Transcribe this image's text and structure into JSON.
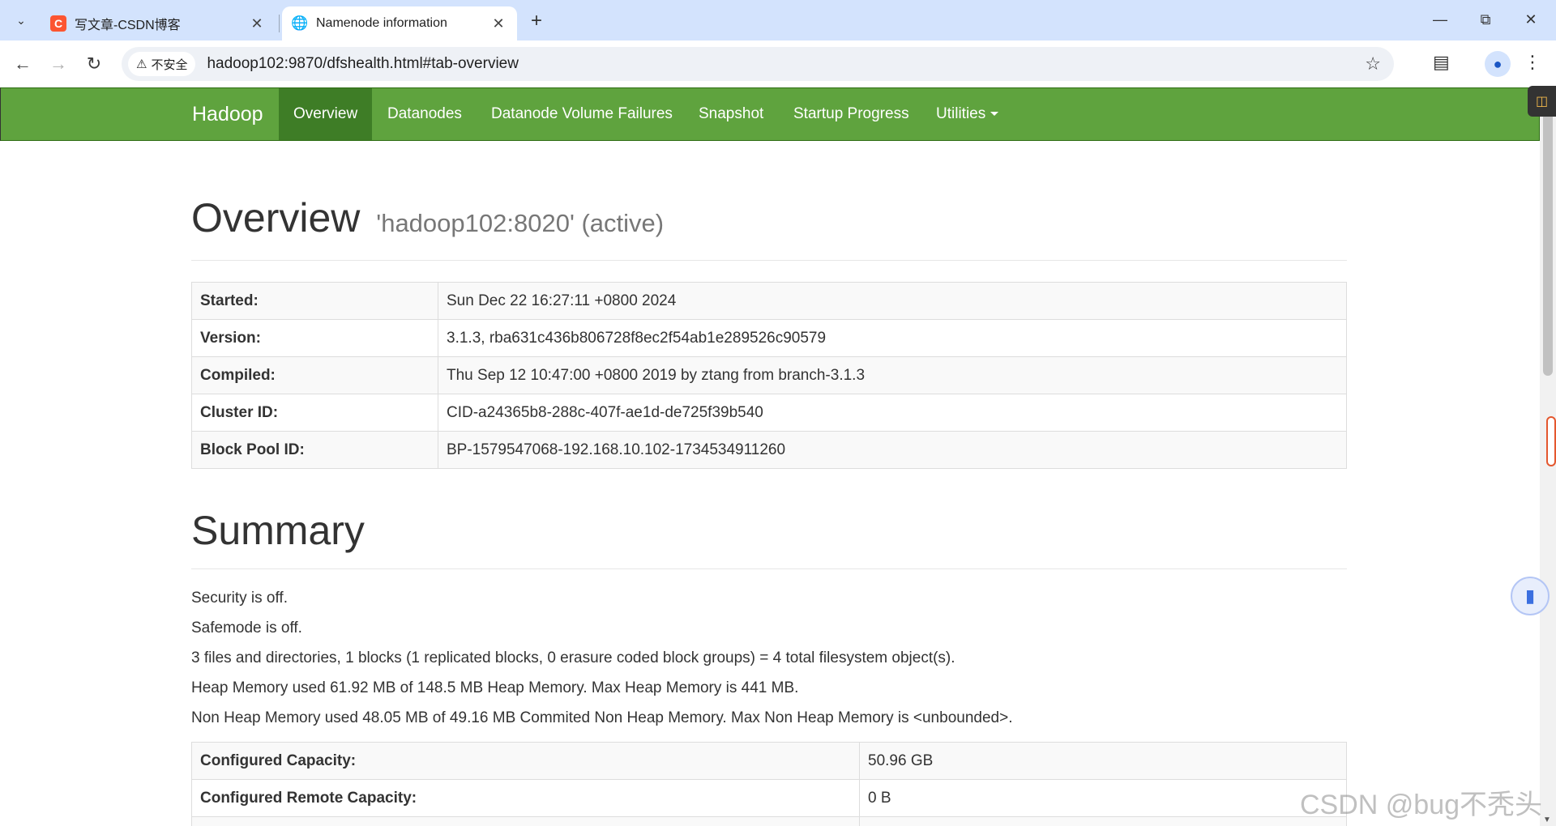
{
  "browser": {
    "tabs": [
      {
        "title": "写文章-CSDN博客",
        "favicon": "csdn-icon",
        "active": false
      },
      {
        "title": "Namenode information",
        "favicon": "globe-icon",
        "active": true
      }
    ],
    "security_label": "不安全",
    "url": "hadoop102:9870/dfshealth.html#tab-overview"
  },
  "navbar": {
    "brand": "Hadoop",
    "items": [
      "Overview",
      "Datanodes",
      "Datanode Volume Failures",
      "Snapshot",
      "Startup Progress",
      "Utilities"
    ],
    "active_item": "Overview"
  },
  "overview": {
    "heading": "Overview",
    "subheading": "'hadoop102:8020' (active)",
    "rows": [
      {
        "key": "Started:",
        "value": "Sun Dec 22 16:27:11 +0800 2024"
      },
      {
        "key": "Version:",
        "value": "3.1.3, rba631c436b806728f8ec2f54ab1e289526c90579"
      },
      {
        "key": "Compiled:",
        "value": "Thu Sep 12 10:47:00 +0800 2019 by ztang from branch-3.1.3"
      },
      {
        "key": "Cluster ID:",
        "value": "CID-a24365b8-288c-407f-ae1d-de725f39b540"
      },
      {
        "key": "Block Pool ID:",
        "value": "BP-1579547068-192.168.10.102-1734534911260"
      }
    ]
  },
  "summary": {
    "heading": "Summary",
    "lines": [
      "Security is off.",
      "Safemode is off.",
      "3 files and directories, 1 blocks (1 replicated blocks, 0 erasure coded block groups) = 4 total filesystem object(s).",
      "Heap Memory used 61.92 MB of 148.5 MB Heap Memory. Max Heap Memory is 441 MB.",
      "Non Heap Memory used 48.05 MB of 49.16 MB Commited Non Heap Memory. Max Non Heap Memory is <unbounded>."
    ],
    "rows": [
      {
        "key": "Configured Capacity:",
        "value": "50.96 GB"
      },
      {
        "key": "Configured Remote Capacity:",
        "value": "0 B"
      }
    ]
  },
  "watermark": "CSDN @bug不秃头"
}
